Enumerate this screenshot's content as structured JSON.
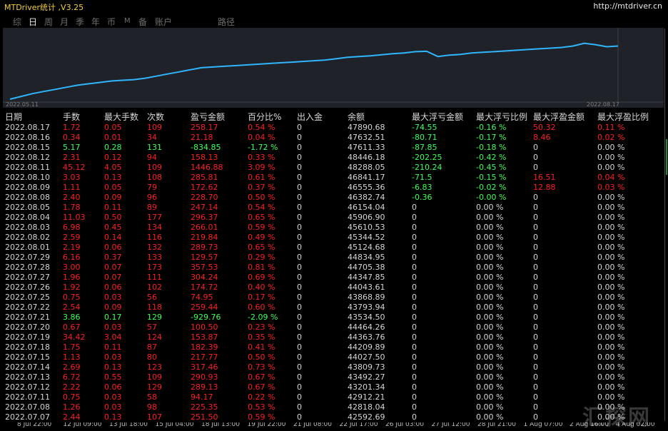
{
  "window": {
    "title": "MTDriver统计 ,V3.25",
    "url": "http://mtdriver.cn"
  },
  "tabs": [
    {
      "label": "综",
      "active": false
    },
    {
      "label": "日",
      "active": true
    },
    {
      "label": "周",
      "active": false
    },
    {
      "label": "月",
      "active": false
    },
    {
      "label": "季",
      "active": false
    },
    {
      "label": "年",
      "active": false
    },
    {
      "label": "币",
      "active": false
    },
    {
      "label": "M",
      "active": false
    },
    {
      "label": "备",
      "active": false
    },
    {
      "label": "账户",
      "active": false
    },
    {
      "label": "路径",
      "active": false
    }
  ],
  "chart_data": {
    "type": "line",
    "x_start_label": "2022.05.11",
    "x_end_label": "2022.08.17",
    "line_color": "#2fb6ff",
    "background": "#1f2329",
    "values": [
      0.0,
      0.04,
      0.08,
      0.11,
      0.14,
      0.17,
      0.2,
      0.22,
      0.24,
      0.26,
      0.27,
      0.28,
      0.3,
      0.33,
      0.36,
      0.39,
      0.42,
      0.45,
      0.46,
      0.47,
      0.48,
      0.49,
      0.5,
      0.51,
      0.52,
      0.53,
      0.54,
      0.55,
      0.56,
      0.58,
      0.6,
      0.61,
      0.62,
      0.635,
      0.65,
      0.66,
      0.68,
      0.685,
      0.61,
      0.63,
      0.64,
      0.66,
      0.67,
      0.68,
      0.69,
      0.7,
      0.71,
      0.72,
      0.73,
      0.74,
      0.76,
      0.8,
      0.78,
      0.75,
      0.76
    ]
  },
  "table": {
    "headers": [
      "日期",
      "手数",
      "最大手数",
      "次数",
      "盈亏金额",
      "百分比%",
      "出入金",
      "余额",
      "最大浮亏金额",
      "最大浮亏比例",
      "最大浮盈金额",
      "最大浮盈比例"
    ],
    "rows": [
      [
        "2022.08.17",
        "1.72",
        "0.05",
        "109",
        "258.17",
        "0.54 %",
        "0",
        "47890.68",
        "-74.55",
        "-0.16 %",
        "50.32",
        "0.11 %"
      ],
      [
        "2022.08.16",
        "0.34",
        "0.01",
        "34",
        "21.18",
        "0.04 %",
        "0",
        "47632.51",
        "-80.71",
        "-0.17 %",
        "8.46",
        "0.02 %"
      ],
      [
        "2022.08.15",
        "5.17",
        "0.28",
        "131",
        "-834.85",
        "-1.72 %",
        "0",
        "47611.33",
        "-87.85",
        "-0.18 %",
        "0",
        "0.00 %"
      ],
      [
        "2022.08.12",
        "2.31",
        "0.12",
        "94",
        "158.13",
        "0.33 %",
        "0",
        "48446.18",
        "-202.25",
        "-0.42 %",
        "0",
        "0.00 %"
      ],
      [
        "2022.08.11",
        "45.12",
        "4.05",
        "109",
        "1446.88",
        "3.09 %",
        "0",
        "48288.05",
        "-210.24",
        "-0.45 %",
        "0",
        "0.00 %"
      ],
      [
        "2022.08.10",
        "3.03",
        "0.13",
        "108",
        "285.81",
        "0.61 %",
        "0",
        "46841.17",
        "-71.5",
        "-0.15 %",
        "16.51",
        "0.04 %"
      ],
      [
        "2022.08.09",
        "1.11",
        "0.05",
        "79",
        "172.62",
        "0.37 %",
        "0",
        "46555.36",
        "-6.83",
        "-0.02 %",
        "12.88",
        "0.03 %"
      ],
      [
        "2022.08.08",
        "2.40",
        "0.09",
        "96",
        "228.70",
        "0.50 %",
        "0",
        "46382.74",
        "-0.36",
        "-0.00 %",
        "0",
        "0.00 %"
      ],
      [
        "2022.08.05",
        "1.78",
        "0.11",
        "89",
        "247.14",
        "0.54 %",
        "0",
        "46154.04",
        "0",
        "0.00 %",
        "0",
        "0.00 %"
      ],
      [
        "2022.08.04",
        "11.03",
        "0.50",
        "177",
        "296.37",
        "0.65 %",
        "0",
        "45906.90",
        "0",
        "0.00 %",
        "0",
        "0.00 %"
      ],
      [
        "2022.08.03",
        "6.98",
        "0.45",
        "134",
        "266.01",
        "0.59 %",
        "0",
        "45610.53",
        "0",
        "0.00 %",
        "0",
        "0.00 %"
      ],
      [
        "2022.08.02",
        "2.59",
        "0.14",
        "116",
        "219.84",
        "0.49 %",
        "0",
        "45344.52",
        "0",
        "0.00 %",
        "0",
        "0.00 %"
      ],
      [
        "2022.08.01",
        "2.19",
        "0.06",
        "132",
        "289.73",
        "0.65 %",
        "0",
        "45124.68",
        "0",
        "0.00 %",
        "0",
        "0.00 %"
      ],
      [
        "2022.07.29",
        "6.16",
        "0.37",
        "133",
        "129.57",
        "0.29 %",
        "0",
        "44834.95",
        "0",
        "0.00 %",
        "0",
        "0.00 %"
      ],
      [
        "2022.07.28",
        "3.00",
        "0.07",
        "173",
        "357.53",
        "0.81 %",
        "0",
        "44705.38",
        "0",
        "0.00 %",
        "0",
        "0.00 %"
      ],
      [
        "2022.07.27",
        "1.96",
        "0.07",
        "111",
        "304.24",
        "0.69 %",
        "0",
        "44347.85",
        "0",
        "0.00 %",
        "0",
        "0.00 %"
      ],
      [
        "2022.07.26",
        "1.92",
        "0.06",
        "102",
        "174.72",
        "0.40 %",
        "0",
        "44043.61",
        "0",
        "0.00 %",
        "0",
        "0.00 %"
      ],
      [
        "2022.07.25",
        "0.75",
        "0.03",
        "56",
        "74.95",
        "0.17 %",
        "0",
        "43868.89",
        "0",
        "0.00 %",
        "0",
        "0.00 %"
      ],
      [
        "2022.07.22",
        "2.54",
        "0.09",
        "118",
        "259.44",
        "0.60 %",
        "0",
        "43793.94",
        "0",
        "0.00 %",
        "0",
        "0.00 %"
      ],
      [
        "2022.07.21",
        "3.86",
        "0.17",
        "129",
        "-929.76",
        "-2.09 %",
        "0",
        "43534.50",
        "0",
        "0.00 %",
        "0",
        "0.00 %"
      ],
      [
        "2022.07.20",
        "0.67",
        "0.03",
        "57",
        "100.50",
        "0.23 %",
        "0",
        "44464.26",
        "0",
        "0.00 %",
        "0",
        "0.00 %"
      ],
      [
        "2022.07.19",
        "34.42",
        "3.04",
        "124",
        "153.87",
        "0.35 %",
        "0",
        "44363.76",
        "0",
        "0.00 %",
        "0",
        "0.00 %"
      ],
      [
        "2022.07.18",
        "1.75",
        "0.11",
        "87",
        "182.39",
        "0.41 %",
        "0",
        "44209.89",
        "0",
        "0.00 %",
        "0",
        "0.00 %"
      ],
      [
        "2022.07.15",
        "1.13",
        "0.03",
        "80",
        "217.77",
        "0.50 %",
        "0",
        "44027.50",
        "0",
        "0.00 %",
        "0",
        "0.00 %"
      ],
      [
        "2022.07.14",
        "2.69",
        "0.13",
        "123",
        "317.46",
        "0.73 %",
        "0",
        "43809.73",
        "0",
        "0.00 %",
        "0",
        "0.00 %"
      ],
      [
        "2022.07.13",
        "6.72",
        "0.55",
        "109",
        "290.93",
        "0.67 %",
        "0",
        "43492.27",
        "0",
        "0.00 %",
        "0",
        "0.00 %"
      ],
      [
        "2022.07.12",
        "2.22",
        "0.06",
        "129",
        "289.13",
        "0.67 %",
        "0",
        "43201.34",
        "0",
        "0.00 %",
        "0",
        "0.00 %"
      ],
      [
        "2022.07.11",
        "0.75",
        "0.03",
        "58",
        "94.17",
        "0.22 %",
        "0",
        "42912.21",
        "0",
        "0.00 %",
        "0",
        "0.00 %"
      ],
      [
        "2022.07.08",
        "1.26",
        "0.03",
        "98",
        "225.35",
        "0.53 %",
        "0",
        "42818.04",
        "0",
        "0.00 %",
        "0",
        "0.00 %"
      ],
      [
        "2022.07.07",
        "2.44",
        "0.13",
        "107",
        "251.50",
        "0.59 %",
        "0",
        "42592.69",
        "0",
        "0.00 %",
        "0",
        "0.00 %"
      ]
    ]
  },
  "bottom_axis": [
    "8 Jul 22:00",
    "12 Jul 09:00",
    "13 Jul 18:00",
    "15 Jul 04:00",
    "18 Jul 13:00",
    "19 Jul 22:00",
    "21 Jul 08:00",
    "22 Jul 17:00",
    "26 Jul 03:00",
    "27 Jul 12:00",
    "28 Jul 21:00",
    "1 Aug 07:00",
    "2 Aug 16:00",
    "4 Aug 02:00"
  ],
  "watermark": "汇探网"
}
